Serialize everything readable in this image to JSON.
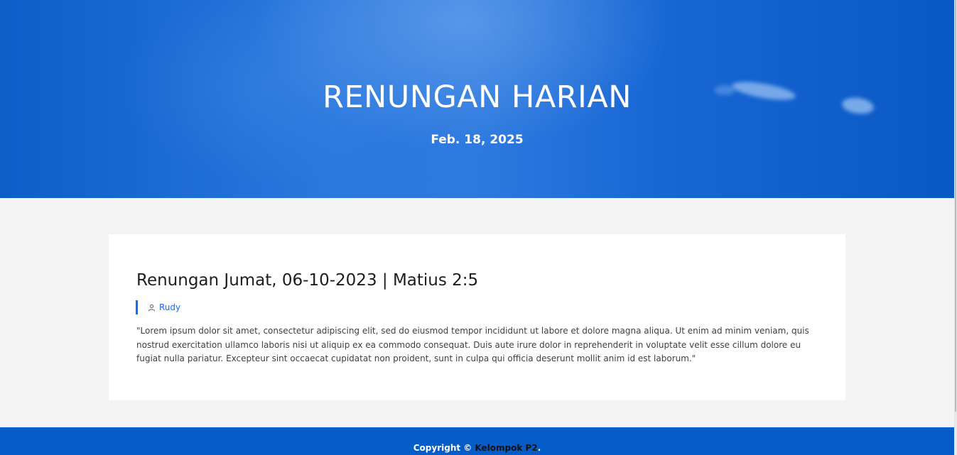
{
  "hero": {
    "title": "RENUNGAN HARIAN",
    "date": "Feb. 18, 2025"
  },
  "post": {
    "title": "Renungan Jumat, 06-10-2023 | Matius 2:5",
    "author_icon": "user-icon",
    "author": "Rudy",
    "body": "\"Lorem ipsum dolor sit amet, consectetur adipiscing elit, sed do eiusmod tempor incididunt ut labore et dolore magna aliqua. Ut enim ad minim veniam, quis nostrud exercitation ullamco laboris nisi ut aliquip ex ea commodo consequat. Duis aute irure dolor in reprehenderit in voluptate velit esse cillum dolore eu fugiat nulla pariatur. Excepteur sint occaecat cupidatat non proident, sunt in culpa qui officia deserunt mollit anim id est laborum.\""
  },
  "footer": {
    "prefix": "Copyright © ",
    "link": "Kelompok P2",
    "suffix": "."
  },
  "colors": {
    "primary": "#055dca",
    "link": "#0d6efd",
    "background": "#f3f3f3"
  }
}
